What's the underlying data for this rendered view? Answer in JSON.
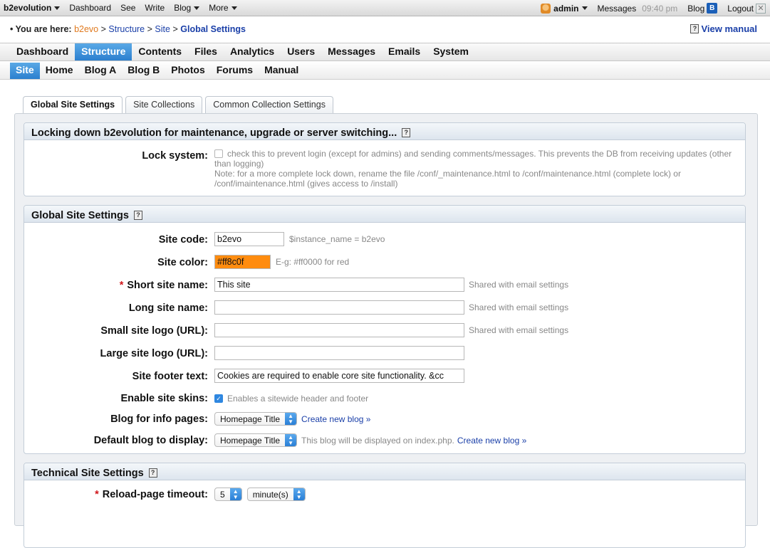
{
  "evobar": {
    "left": [
      {
        "label": "b2evolution",
        "dropdown": true
      },
      {
        "label": "Dashboard",
        "dropdown": false
      },
      {
        "label": "See",
        "dropdown": false
      },
      {
        "label": "Write",
        "dropdown": false
      },
      {
        "label": "Blog",
        "dropdown": true
      },
      {
        "label": "More",
        "dropdown": true
      }
    ],
    "user": "admin",
    "messages": "Messages",
    "time": "09:40 pm",
    "blog": "Blog",
    "blog_icon": "B",
    "logout": "Logout"
  },
  "breadcrumb": {
    "prefix": "• You are here:",
    "items": [
      "b2evo",
      "Structure",
      "Site"
    ],
    "current": "Global Settings",
    "sep": ">"
  },
  "view_manual": "View manual",
  "main_menu": [
    "Dashboard",
    "Structure",
    "Contents",
    "Files",
    "Analytics",
    "Users",
    "Messages",
    "Emails",
    "System"
  ],
  "main_menu_active": "Structure",
  "sub_menu": [
    "Site",
    "Home",
    "Blog A",
    "Blog B",
    "Photos",
    "Forums",
    "Manual"
  ],
  "sub_menu_active": "Site",
  "tabs": [
    "Global Site Settings",
    "Site Collections",
    "Common Collection Settings"
  ],
  "tab_active": "Global Site Settings",
  "lock_section": {
    "title": "Locking down b2evolution for maintenance, upgrade or server switching...",
    "label": "Lock system:",
    "checked": false,
    "desc1": "check this to prevent login (except for admins) and sending comments/messages. This prevents the DB from receiving updates (other than logging)",
    "desc2": "Note: for a more complete lock down, rename the file /conf/_maintenance.html to /conf/maintenance.html (complete lock) or /conf/imaintenance.html (gives access to /install)"
  },
  "global_section": {
    "title": "Global Site Settings",
    "site_code": {
      "label": "Site code:",
      "value": "b2evo",
      "note": "$instance_name = b2evo"
    },
    "site_color": {
      "label": "Site color:",
      "value": "#ff8c0f",
      "color": "#ff8c0f",
      "note": "E-g: #ff0000 for red"
    },
    "short_name": {
      "label": "Short site name:",
      "value": "This site",
      "note": "Shared with email settings"
    },
    "long_name": {
      "label": "Long site name:",
      "value": "",
      "note": "Shared with email settings"
    },
    "small_logo": {
      "label": "Small site logo (URL):",
      "value": "",
      "note": "Shared with email settings"
    },
    "large_logo": {
      "label": "Large site logo (URL):",
      "value": ""
    },
    "footer_text": {
      "label": "Site footer text:",
      "value": "Cookies are required to enable core site functionality. &cc"
    },
    "enable_skins": {
      "label": "Enable site skins:",
      "checked": true,
      "note": "Enables a sitewide header and footer"
    },
    "info_blog": {
      "label": "Blog for info pages:",
      "value": "Homepage Title",
      "link": "Create new blog »"
    },
    "default_blog": {
      "label": "Default blog to display:",
      "value": "Homepage Title",
      "note": "This blog will be displayed on index.php.",
      "link": "Create new blog »"
    }
  },
  "technical_section": {
    "title": "Technical Site Settings",
    "reload": {
      "label": "Reload-page timeout:",
      "value": "5",
      "unit": "minute(s)"
    }
  }
}
